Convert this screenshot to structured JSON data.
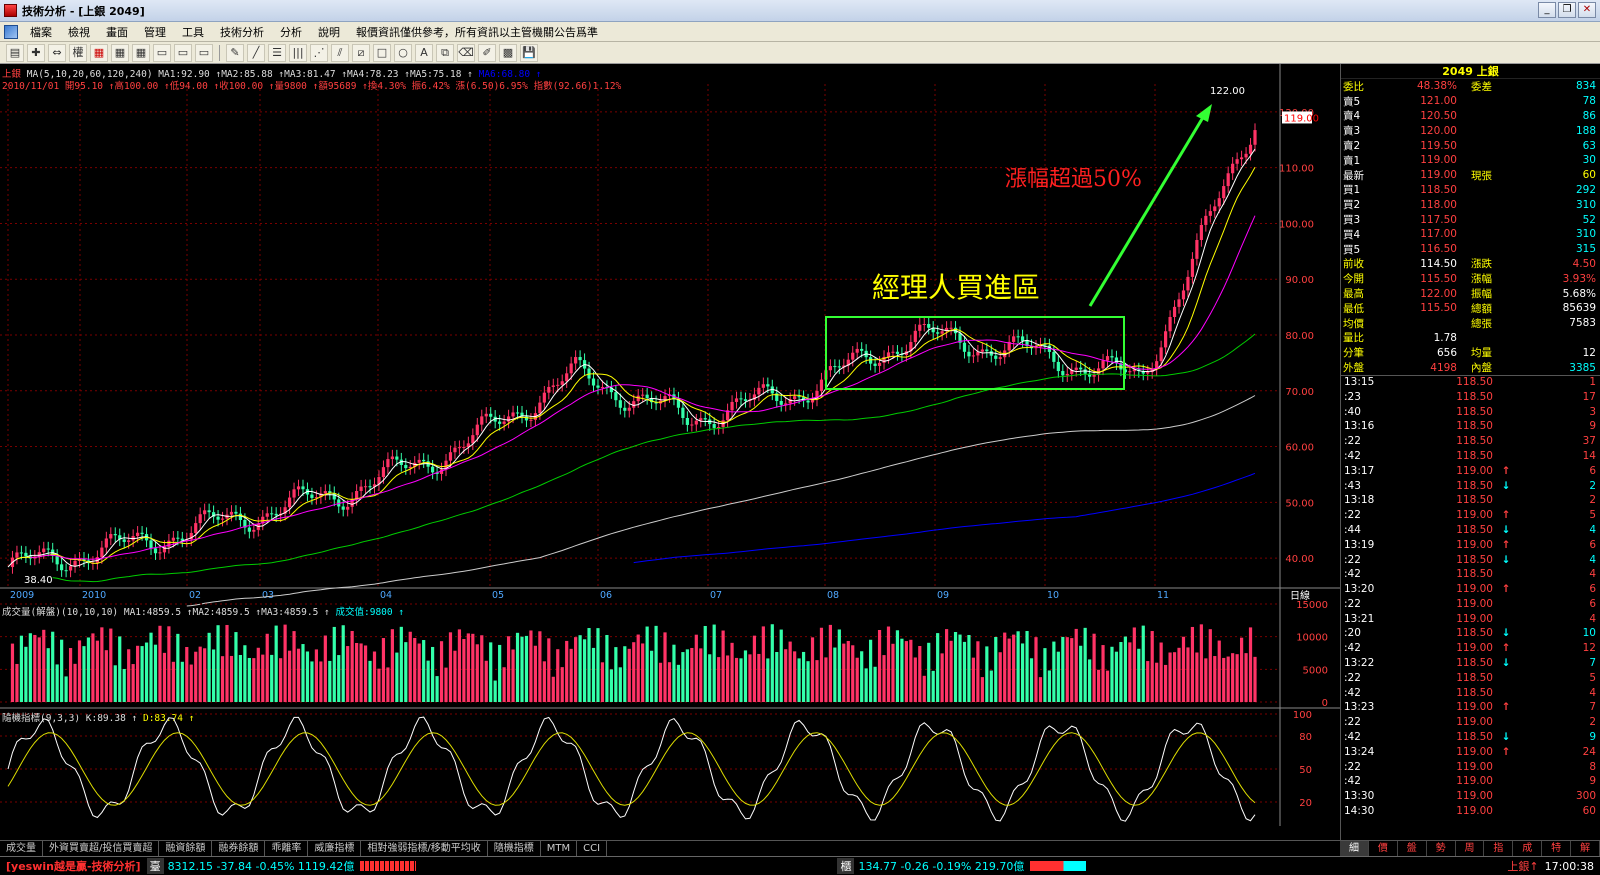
{
  "window": {
    "title": "技術分析 - [上銀 2049]",
    "controls": [
      "_",
      "❐",
      "✕"
    ]
  },
  "menu": [
    "檔案",
    "檢視",
    "畫面",
    "管理",
    "工具",
    "技術分析",
    "分析",
    "說明",
    "報價資訊僅供參考，所有資訊以主管機關公告爲準"
  ],
  "toolbar": {
    "tool_label": "權"
  },
  "chart_header": {
    "name": "上銀",
    "ma_line": "MA(5,10,20,60,120,240) MA1:92.90 ↑MA2:85.88 ↑MA3:81.47 ↑MA4:78.23 ↑MA5:75.18 ↑",
    "ma6_label": "MA6:68.80 ↑",
    "bar_line": "2010/11/01 開95.10 ↑高100.00 ↑低94.00 ↑收100.00 ↑量9800 ↑額95689 ↑換4.30% 振6.42% 漲(6.50)6.95% 指數(92.66)1.12%",
    "volume_line": "成交量(解盤)(10,10,10) MA1:4859.5 ↑MA2:4859.5 ↑MA3:4859.5 ↑",
    "volume_val": "成交值:9800 ↑",
    "kd_line": "隨機指標(9,3,3) K:89.38 ↑",
    "kd_d": "D:83.74 ↑"
  },
  "annotations": {
    "rise": "漲幅超過50%",
    "box": "經理人買進區",
    "peak_price": "122.00",
    "low_price": "38.40",
    "last_price_tag": "119.00"
  },
  "axes": {
    "price_ticks": [
      "120.00",
      "110.00",
      "100.00",
      "90.00",
      "80.00",
      "70.00",
      "60.00",
      "50.00",
      "40.00"
    ],
    "time_ticks": [
      "2009",
      "2010",
      "02",
      "03",
      "04",
      "05",
      "06",
      "07",
      "08",
      "09",
      "10",
      "11"
    ],
    "right_label": "日線",
    "vol_ticks": [
      "15000",
      "10000",
      "5000",
      "0"
    ],
    "kd_ticks": [
      "100",
      "80",
      "50",
      "20"
    ]
  },
  "chart_data": {
    "type": "line",
    "title": "上銀 2049",
    "x": [
      "2009",
      "2010",
      "02",
      "03",
      "04",
      "05",
      "06",
      "07",
      "08",
      "09",
      "10",
      "11"
    ],
    "series": [
      {
        "name": "收盤",
        "values": [
          38.4,
          42,
          47,
          52,
          60,
          73,
          65,
          70,
          80,
          77,
          72,
          119
        ]
      }
    ],
    "ylim": [
      35,
      125
    ]
  },
  "quote": {
    "header": "2049 上銀",
    "rows": [
      {
        "l": "委比",
        "v": "48.38%",
        "l2": "委差",
        "v2": "834",
        "c": "#ff4040",
        "c2": "#0ff"
      },
      {
        "l": "賣5",
        "v": "121.00",
        "v2": "78",
        "c": "#ff4040",
        "c2": "#0ff"
      },
      {
        "l": "賣4",
        "v": "120.50",
        "v2": "86",
        "c": "#ff4040",
        "c2": "#0ff"
      },
      {
        "l": "賣3",
        "v": "120.00",
        "v2": "188",
        "c": "#ff4040",
        "c2": "#0ff"
      },
      {
        "l": "賣2",
        "v": "119.50",
        "v2": "63",
        "c": "#ff4040",
        "c2": "#0ff"
      },
      {
        "l": "賣1",
        "v": "119.00",
        "v2": "30",
        "c": "#ff4040",
        "c2": "#0ff"
      },
      {
        "l": "最新",
        "v": "119.00",
        "l2": "現張",
        "v2": "60",
        "c": "#ff4040",
        "c2": "#ffff00"
      },
      {
        "l": "買1",
        "v": "118.50",
        "v2": "292",
        "c": "#ff4040",
        "c2": "#0ff"
      },
      {
        "l": "買2",
        "v": "118.00",
        "v2": "310",
        "c": "#ff4040",
        "c2": "#0ff"
      },
      {
        "l": "買3",
        "v": "117.50",
        "v2": "52",
        "c": "#ff4040",
        "c2": "#0ff"
      },
      {
        "l": "買4",
        "v": "117.00",
        "v2": "310",
        "c": "#ff4040",
        "c2": "#0ff"
      },
      {
        "l": "買5",
        "v": "116.50",
        "v2": "315",
        "c": "#ff4040",
        "c2": "#0ff"
      },
      {
        "l": "前收",
        "v": "114.50",
        "l2": "漲跌",
        "v2": "4.50",
        "c": "#fff",
        "c2": "#ff4040"
      },
      {
        "l": "今開",
        "v": "115.50",
        "l2": "漲幅",
        "v2": "3.93%",
        "c": "#ff4040",
        "c2": "#ff4040"
      },
      {
        "l": "最高",
        "v": "122.00",
        "l2": "振幅",
        "v2": "5.68%",
        "c": "#ff4040",
        "c2": "#fff"
      },
      {
        "l": "最低",
        "v": "115.50",
        "l2": "總額",
        "v2": "85639",
        "c": "#ff4040",
        "c2": "#fff"
      },
      {
        "l": "均價",
        "v": "",
        "l2": "總張",
        "v2": "7583",
        "c": "#fff",
        "c2": "#fff"
      },
      {
        "l": "量比",
        "v": "1.78",
        "l2": "",
        "v2": "",
        "c": "#fff",
        "c2": "#fff"
      },
      {
        "l": "分筆",
        "v": "656",
        "l2": "均量",
        "v2": "12",
        "c": "#fff",
        "c2": "#fff"
      },
      {
        "l": "外盤",
        "v": "4198",
        "l2": "內盤",
        "v2": "3385",
        "c": "#ff4040",
        "c2": "#0ff"
      }
    ]
  },
  "ticks": [
    {
      "t": "13:15",
      "p": "118.50",
      "a": "",
      "v": "1"
    },
    {
      "t": ":23",
      "p": "118.50",
      "a": "",
      "v": "17"
    },
    {
      "t": ":40",
      "p": "118.50",
      "a": "",
      "v": "3"
    },
    {
      "t": "13:16",
      "p": "118.50",
      "a": "",
      "v": "9"
    },
    {
      "t": ":22",
      "p": "118.50",
      "a": "",
      "v": "37"
    },
    {
      "t": ":42",
      "p": "118.50",
      "a": "",
      "v": "14"
    },
    {
      "t": "13:17",
      "p": "119.00",
      "a": "↑",
      "v": "6"
    },
    {
      "t": ":43",
      "p": "118.50",
      "a": "↓",
      "v": "2"
    },
    {
      "t": "13:18",
      "p": "118.50",
      "a": "",
      "v": "2"
    },
    {
      "t": ":22",
      "p": "119.00",
      "a": "↑",
      "v": "5"
    },
    {
      "t": ":44",
      "p": "118.50",
      "a": "↓",
      "v": "4"
    },
    {
      "t": "13:19",
      "p": "119.00",
      "a": "↑",
      "v": "6"
    },
    {
      "t": ":22",
      "p": "118.50",
      "a": "↓",
      "v": "4"
    },
    {
      "t": ":42",
      "p": "118.50",
      "a": "",
      "v": "4"
    },
    {
      "t": "13:20",
      "p": "119.00",
      "a": "↑",
      "v": "6"
    },
    {
      "t": ":22",
      "p": "119.00",
      "a": "",
      "v": "6"
    },
    {
      "t": "13:21",
      "p": "119.00",
      "a": "",
      "v": "4"
    },
    {
      "t": ":20",
      "p": "118.50",
      "a": "↓",
      "v": "10"
    },
    {
      "t": ":42",
      "p": "119.00",
      "a": "↑",
      "v": "12"
    },
    {
      "t": "13:22",
      "p": "118.50",
      "a": "↓",
      "v": "7"
    },
    {
      "t": ":22",
      "p": "118.50",
      "a": "",
      "v": "5"
    },
    {
      "t": ":42",
      "p": "118.50",
      "a": "",
      "v": "4"
    },
    {
      "t": "13:23",
      "p": "119.00",
      "a": "↑",
      "v": "7"
    },
    {
      "t": ":22",
      "p": "119.00",
      "a": "",
      "v": "2"
    },
    {
      "t": ":42",
      "p": "118.50",
      "a": "↓",
      "v": "9"
    },
    {
      "t": "13:24",
      "p": "119.00",
      "a": "↑",
      "v": "24"
    },
    {
      "t": ":22",
      "p": "119.00",
      "a": "",
      "v": "8"
    },
    {
      "t": ":42",
      "p": "119.00",
      "a": "",
      "v": "9"
    },
    {
      "t": "13:30",
      "p": "119.00",
      "a": "",
      "v": "300"
    },
    {
      "t": "14:30",
      "p": "119.00",
      "a": "",
      "v": "60"
    }
  ],
  "indicator_tabs": [
    "成交量",
    "外資買賣超/投信買賣超",
    "融資餘額",
    "融券餘額",
    "乖離率",
    "威廉指標",
    "相對強弱指標/移動平均收",
    "隨機指標",
    "MTM",
    "CCI"
  ],
  "quote_tabs": [
    "細",
    "價",
    "盤",
    "勢",
    "周",
    "指",
    "成",
    "特",
    "解"
  ],
  "status": {
    "brand": "[yeswin越是贏-技術分析]",
    "tw_mark": "臺",
    "tw_vals": "8312.15 -37.84 -0.45% 1119.42億",
    "otc_mark": "櫃",
    "otc_vals": "134.77 -0.26 -0.19% 219.70億",
    "stock": "上銀↑",
    "time": "17:00:38"
  }
}
